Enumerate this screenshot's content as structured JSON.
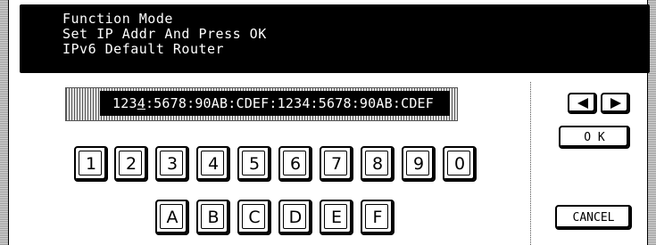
{
  "header": {
    "line1": "Function Mode",
    "line2": "Set IP Addr And Press OK",
    "line3": "IPv6 Default Router"
  },
  "address": {
    "before_cursor": "123",
    "cursor_char": "4",
    "after_cursor": ":5678:90AB:CDEF:1234:5678:90AB:CDEF"
  },
  "keys": {
    "digits": [
      "1",
      "2",
      "3",
      "4",
      "5",
      "6",
      "7",
      "8",
      "9",
      "0"
    ],
    "letters": [
      "A",
      "B",
      "C",
      "D",
      "E",
      "F"
    ]
  },
  "controls": {
    "left_arrow": "left-arrow-icon",
    "right_arrow": "right-arrow-icon",
    "ok_label": "O K",
    "cancel_label": "CANCEL"
  }
}
